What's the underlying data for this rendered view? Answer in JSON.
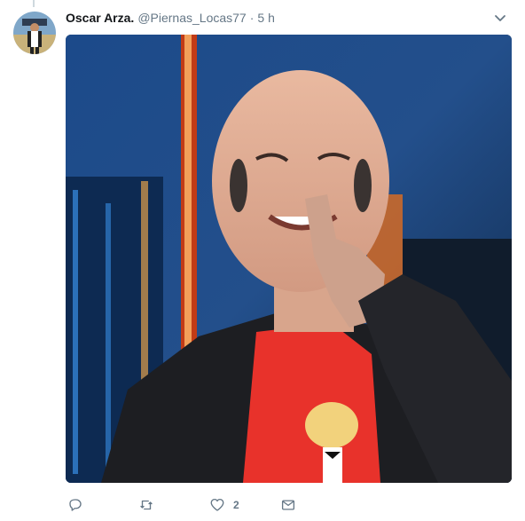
{
  "tweet": {
    "author_name": "Oscar Arza.",
    "author_handle": "@Piernas_Locas77",
    "separator": "·",
    "timestamp": "5 h"
  },
  "actions": {
    "reply": {
      "icon": "reply-icon",
      "count": ""
    },
    "retweet": {
      "icon": "retweet-icon",
      "count": ""
    },
    "like": {
      "icon": "heart-icon",
      "count": "2"
    },
    "dm": {
      "icon": "envelope-icon",
      "count": ""
    }
  },
  "media": {
    "description_icon": "photo"
  },
  "colors": {
    "muted": "#657786",
    "shirt": "#e8322b",
    "stage_blue": "#1f4d8f"
  }
}
